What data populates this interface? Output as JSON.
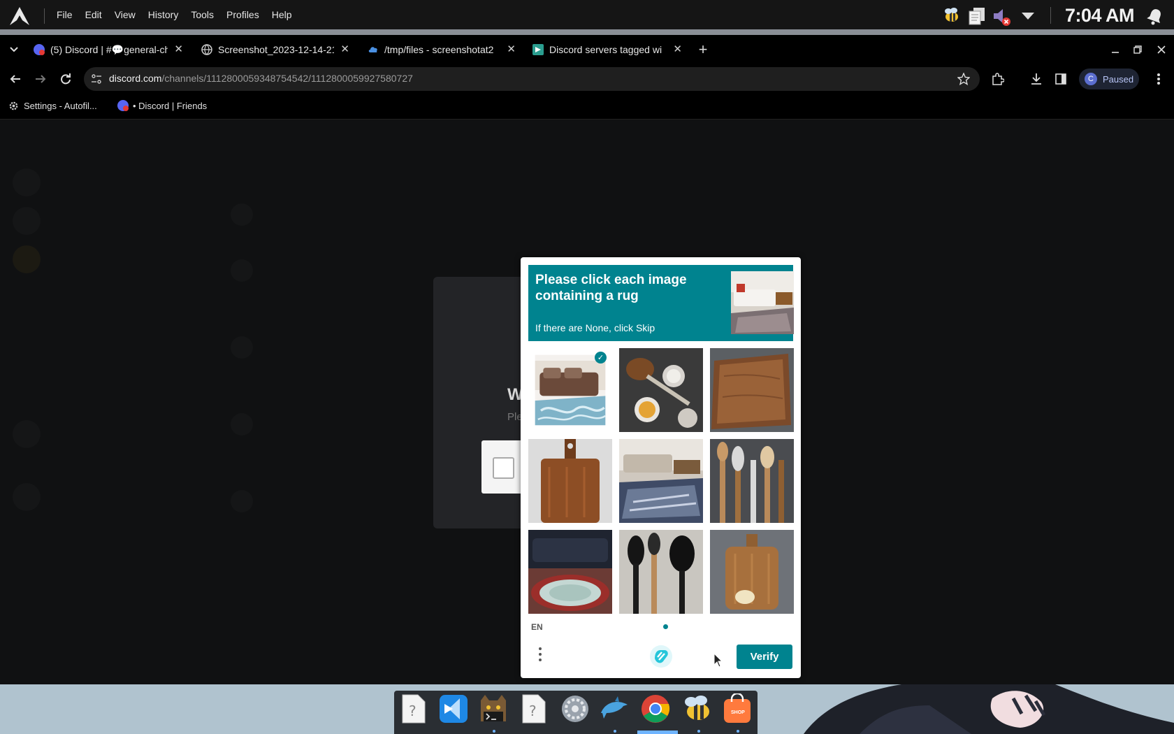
{
  "menubar": {
    "menus": [
      "File",
      "Edit",
      "View",
      "History",
      "Tools",
      "Profiles",
      "Help"
    ],
    "clock": "7:04 AM",
    "icons": [
      "arch-linux-logo",
      "bee-icon",
      "clipboard-icon",
      "volume-muted-icon",
      "dropdown-icon",
      "notification-bell-icon"
    ]
  },
  "tabs": [
    {
      "title": "(5) Discord | #💬general-ch",
      "icon": "discord-favicon"
    },
    {
      "title": "Screenshot_2023-12-14-21",
      "icon": "globe-icon"
    },
    {
      "title": "/tmp/files - screenshotat2",
      "icon": "cloud-icon"
    },
    {
      "title": "Discord servers tagged wi",
      "icon": "disboard-favicon"
    }
  ],
  "address": {
    "domain": "discord.com",
    "path": "/channels/1112800059348754542/1112800059927580727"
  },
  "profile": {
    "initial": "C",
    "label": "Paused"
  },
  "bookmarks": [
    {
      "label": "Settings - Autofil...",
      "icon": "gear-icon"
    },
    {
      "label": "• Discord | Friends",
      "icon": "discord-favicon"
    }
  ],
  "background_modal": {
    "heading": "W",
    "subtext": "Ple"
  },
  "captcha": {
    "prompt": "Please click each image containing a rug",
    "hint": "If there are None, click Skip",
    "language": "EN",
    "verify_label": "Verify",
    "tiles": [
      {
        "name": "tile-sofa-rug",
        "selected": true
      },
      {
        "name": "tile-spoons-bowls",
        "selected": false
      },
      {
        "name": "tile-cutting-board",
        "selected": false
      },
      {
        "name": "tile-paddle-board",
        "selected": false
      },
      {
        "name": "tile-living-room-rug",
        "selected": false
      },
      {
        "name": "tile-utensils",
        "selected": false
      },
      {
        "name": "tile-round-rug",
        "selected": false
      },
      {
        "name": "tile-black-utensils",
        "selected": false
      },
      {
        "name": "tile-board-cheese",
        "selected": false
      }
    ]
  },
  "dock": {
    "apps": [
      "unknown-file",
      "vscode",
      "terminal-cat",
      "unknown-file",
      "system-settings",
      "dolphin",
      "chrome",
      "bee-app",
      "shop"
    ],
    "shop_label": "SHOP"
  },
  "colors": {
    "accent": "#00838f",
    "menubar": "#151515",
    "tabstrip": "#000000"
  }
}
